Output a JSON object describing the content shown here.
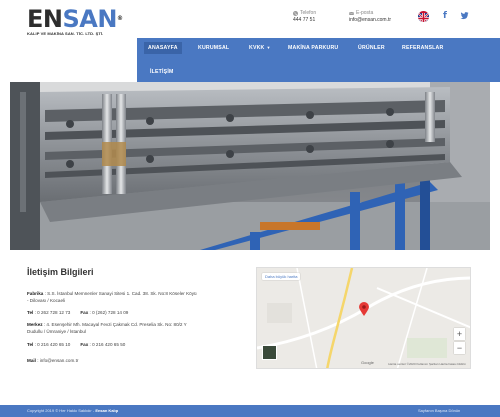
{
  "header": {
    "logo": {
      "word_a": "EN",
      "word_b": "SAN",
      "tm": "®",
      "subtitle": "KALIP VE MAKİNA SAN. TİC. LTD. ŞTİ."
    },
    "phone": {
      "label": "Telefon",
      "value": "444 77 51"
    },
    "email": {
      "label": "E-posta",
      "value": "info@ensan.com.tr"
    },
    "flag_icon": "uk-flag-icon",
    "social": {
      "facebook": "f",
      "twitter": "t"
    }
  },
  "nav": {
    "items": [
      {
        "label": "ANASAYFA",
        "active": true
      },
      {
        "label": "KURUMSAL",
        "active": false
      },
      {
        "label": "KVKK",
        "dropdown": "▼"
      },
      {
        "label": "MAKİNA PARKURU"
      },
      {
        "label": "ÜRÜNLER"
      },
      {
        "label": "REFERANSLAR"
      },
      {
        "label": "İLETİŞİM"
      }
    ]
  },
  "contact": {
    "title": "İletişim Bilgileri",
    "factory_label": "Fabrika",
    "factory_address_1": ": S.S. İstanbul Memnenler Sanayi Sitesi 1. Cad. 38. Sk. No:8 Köseler Köyü",
    "factory_address_2": "- Dilovası / Kocaeli",
    "factory_tel_label": "Tel",
    "factory_tel": ": 0 262 728 12 73",
    "factory_fax_label": "Fax",
    "factory_fax": ": 0 (262) 728 14 09",
    "office_label": "Merkez",
    "office_address_1": ": 4. Esenşehir Mh. Macayal Fevzi Çakmak Cd. Preselia Sk. No: 80/2 Y",
    "office_address_2": "Dudullu / Ümraniye / İstanbul",
    "office_tel_label": "Tel",
    "office_tel": ": 0 216 420 65 10",
    "office_fax_label": "Fax",
    "office_fax": ": 0 216 420 65 50",
    "mail_label": "Mail",
    "mail": ": info@ensan.com.tr"
  },
  "map": {
    "view_label": "Daha büyük harita",
    "zoom_in": "+",
    "zoom_out": "−",
    "google": "Google",
    "footer": "Harita verileri ©2020   Kullanım Şartları   Harita hatası bildirin"
  },
  "footer": {
    "left_prefix": "Copyright 2019 © Her Hakkı Saklıdır - ",
    "left_brand": "Ensan Kalıp",
    "right": "Sayfanın Başına Dönün"
  },
  "colors": {
    "brand": "#4a78c2",
    "dark": "#2d2d2d"
  }
}
